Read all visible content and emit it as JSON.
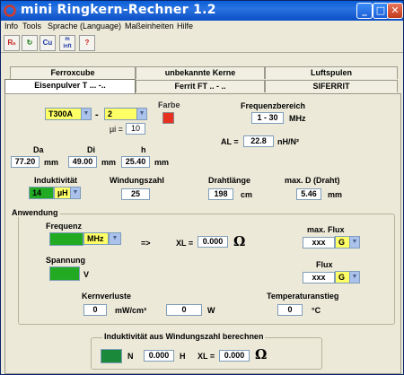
{
  "window": {
    "title": "mini Ringkern-Rechner 1.2"
  },
  "menu": [
    "Info",
    "Tools",
    "Sprache (Language)",
    "Maßeinheiten",
    "Hilfe"
  ],
  "toolbar": {
    "t1": "Rₙ",
    "t2": "Cu",
    "t3": "m inft",
    "t4": "?"
  },
  "tabs": {
    "row1": [
      "Ferroxcube",
      "unbekannte Kerne",
      "Luftspulen"
    ],
    "row2": [
      "Eisenpulver T ... -..",
      "Ferrit FT .. - ..",
      "SIFERRIT"
    ]
  },
  "core": {
    "type": "T300A",
    "mix": "2",
    "mui_label": "µi =",
    "mui_value": "10",
    "farbe_label": "Farbe",
    "color": "#e83020"
  },
  "frequenzbereich": {
    "label": "Frequenzbereich",
    "value": "1 - 30",
    "unit": "MHz"
  },
  "al": {
    "label": "AL =",
    "value": "22.8",
    "unit": "nH/N²"
  },
  "dims": {
    "da_label": "Da",
    "da_value": "77.20",
    "di_label": "Di",
    "di_value": "49.00",
    "h_label": "h",
    "h_value": "25.40",
    "unit": "mm"
  },
  "row3": {
    "ind_label": "Induktivität",
    "ind_value": "14",
    "ind_unit": "µH",
    "wind_label": "Windungszahl",
    "wind_value": "25",
    "draht_label": "Drahtlänge",
    "draht_value": "198",
    "draht_unit": "cm",
    "maxd_label": "max. D (Draht)",
    "maxd_value": "5.46",
    "maxd_unit": "mm"
  },
  "anwendung": {
    "legend": "Anwendung",
    "freq_label": "Frequenz",
    "freq_unit": "MHz",
    "arrow": "=>",
    "xl_label": "XL =",
    "xl_value": "0.000",
    "omega": "Ω",
    "maxflux_label": "max. Flux",
    "maxflux_value": "xxx",
    "maxflux_unit": "G",
    "spannung_label": "Spannung",
    "spannung_unit": "V",
    "flux_label": "Flux",
    "flux_value": "xxx",
    "flux_unit": "G",
    "kern_label": "Kernverluste",
    "kern_value": "0",
    "kern_unit": "mW/cm³",
    "w_value": "0",
    "w_unit": "W",
    "temp_label": "Temperaturanstieg",
    "temp_value": "0",
    "temp_unit": "°C"
  },
  "calc": {
    "legend": "Induktivität aus Windungszahl berechnen",
    "n_label": "N",
    "h_value": "0.000",
    "h_unit": "H",
    "xl_label": "XL =",
    "xl_value": "0.000",
    "omega": "Ω"
  }
}
